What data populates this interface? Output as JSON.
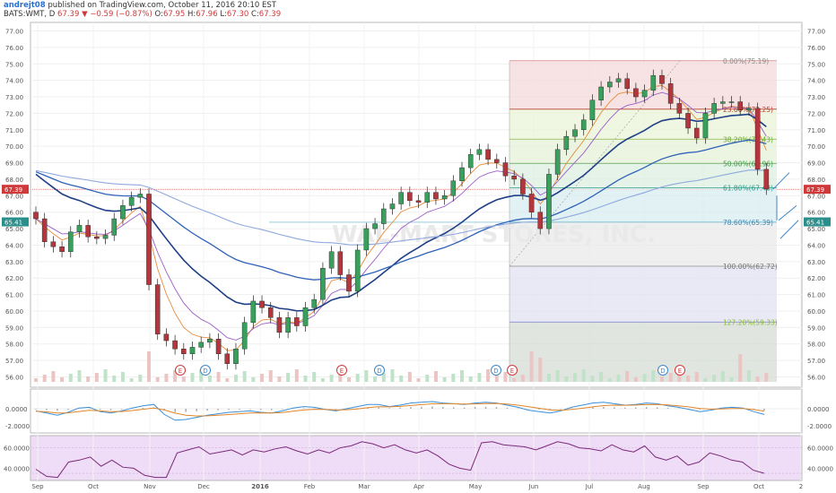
{
  "header": {
    "user": "andrejt08",
    "published": "published on TradingView.com, October 11, 2016 20:10 EST",
    "symbol": "BATS:WMT, D",
    "last": "67.39",
    "change": "−0.59 (−0.87%)",
    "o_label": "O:",
    "o_value": "67.95",
    "h_label": "H:",
    "h_value": "67.96",
    "l_label": "L:",
    "l_value": "67.30",
    "c_label": "C:",
    "c_value": "67.39"
  },
  "colors": {
    "up": "#3a9e5c",
    "down": "#b2363b",
    "ema_dark": "#1f3f86",
    "ema_mid": "#2e62b8",
    "ema_light": "#8fa9dd",
    "ema_orange": "#e88b3a",
    "ema_purple": "#9c5ec8",
    "rsi_line": "#7a2a7a",
    "rsi_bg": "#efdcf6",
    "macd_blue": "#3a8fd8",
    "macd_orange": "#e0862a"
  },
  "watermark": "WAL‑MART STORES, INC.",
  "chart_data": {
    "type": "candlestick",
    "symbol": "BATS:WMT",
    "interval": "D",
    "y_ticks": [
      "77.00",
      "76.00",
      "75.00",
      "74.00",
      "73.00",
      "72.00",
      "71.00",
      "70.00",
      "69.00",
      "68.00",
      "67.00",
      "66.00",
      "65.00",
      "64.00",
      "63.00",
      "62.00",
      "61.00",
      "60.00",
      "59.00",
      "58.00",
      "57.00",
      "56.00"
    ],
    "ylim": [
      55.7,
      77.3
    ],
    "price_labels": [
      {
        "value": 67.39,
        "text": "67.39",
        "color": "#d0393a"
      },
      {
        "value": 65.41,
        "text": "65.41",
        "color": "#2a8f8a"
      }
    ],
    "x_ticks": [
      "Sep",
      "Oct",
      "Nov",
      "Dec",
      "2016",
      "Feb",
      "Mar",
      "Apr",
      "May",
      "Jun",
      "Jul",
      "Aug",
      "Sep",
      "Oct",
      "2"
    ],
    "fibonacci": [
      {
        "level": "0.00%",
        "price": 75.19,
        "label": "0.00%(75.19)"
      },
      {
        "level": "23.60%",
        "price": 72.25,
        "label": "23.60%(72.25)"
      },
      {
        "level": "38.20%",
        "price": 70.43,
        "label": "38.20%(70.43)"
      },
      {
        "level": "50.00%",
        "price": 68.96,
        "label": "50.00%(68.96)"
      },
      {
        "level": "61.80%",
        "price": 67.48,
        "label": "61.80%(67.48)"
      },
      {
        "level": "78.60%",
        "price": 65.39,
        "label": "78.60%(65.39)"
      },
      {
        "level": "100.00%",
        "price": 62.72,
        "label": "100.00%(62.72)"
      },
      {
        "level": "127.20%",
        "price": 59.33,
        "label": "127.20%(59.33)"
      }
    ],
    "events": [
      {
        "type": "E",
        "month": "Nov"
      },
      {
        "type": "D",
        "month": "Dec"
      },
      {
        "type": "E",
        "month": "Feb"
      },
      {
        "type": "D",
        "month": "Mar"
      },
      {
        "type": "D",
        "month": "May"
      },
      {
        "type": "E",
        "month": "May"
      },
      {
        "type": "D",
        "month": "Aug"
      },
      {
        "type": "E",
        "month": "Aug"
      }
    ],
    "series": [
      {
        "name": "close",
        "values": [
          65.6,
          64.2,
          63.9,
          63.6,
          64.8,
          65.2,
          64.5,
          64.4,
          64.6,
          65.6,
          66.4,
          66.9,
          67.1,
          61.6,
          58.6,
          58.2,
          57.7,
          57.4,
          57.8,
          58.1,
          58.3,
          57.4,
          56.8,
          57.7,
          59.3,
          60.6,
          60.2,
          59.6,
          58.7,
          59.6,
          59.1,
          60.2,
          60.7,
          62.6,
          63.6,
          62.2,
          61.2,
          63.7,
          65.0,
          65.3,
          66.2,
          66.5,
          67.2,
          66.7,
          66.6,
          67.2,
          66.8,
          67.0,
          67.9,
          68.7,
          69.5,
          69.8,
          69.2,
          69.0,
          68.2,
          68.0,
          67.1,
          66.0,
          65.0,
          68.3,
          69.8,
          70.6,
          71.0,
          71.6,
          72.8,
          73.6,
          73.9,
          74.1,
          73.5,
          73.0,
          73.4,
          74.3,
          73.8,
          72.6,
          72.0,
          71.1,
          70.5,
          72.0,
          72.6,
          72.7,
          72.7,
          72.2,
          72.3,
          68.6,
          67.4
        ]
      },
      {
        "name": "macd",
        "values": [
          -0.3,
          -0.6,
          -0.9,
          -0.5,
          0.1,
          0.2,
          -0.4,
          -0.6,
          -0.3,
          0.1,
          0.4,
          0.6,
          -0.8,
          -1.6,
          -1.5,
          -1.2,
          -0.9,
          -0.7,
          -0.5,
          -0.4,
          -0.3,
          -0.5,
          -0.6,
          -0.3,
          0.1,
          0.3,
          0.2,
          -0.1,
          -0.3,
          0,
          0.3,
          0.6,
          0.6,
          0.3,
          0.5,
          0.8,
          0.9,
          1,
          0.8,
          0.7,
          0.6,
          0.8,
          0.9,
          0.8,
          0.5,
          0.2,
          -0.2,
          -0.4,
          -0.6,
          -0.3,
          0.2,
          0.5,
          0.8,
          0.9,
          0.7,
          0.5,
          0.6,
          0.8,
          0.7,
          0.4,
          0.2,
          -0.1,
          -0.4,
          -0.2,
          0.1,
          0.2,
          0.1,
          -0.4,
          -0.8
        ]
      },
      {
        "name": "rsi",
        "values": [
          39,
          32,
          31,
          46,
          48,
          51,
          42,
          48,
          41,
          40,
          33,
          31,
          31,
          55,
          58,
          61,
          54,
          56,
          58,
          53,
          58,
          56,
          59,
          61,
          57,
          54,
          58,
          55,
          60,
          62,
          66,
          64,
          60,
          63,
          58,
          55,
          58,
          52,
          44,
          40,
          38,
          65,
          66,
          63,
          62,
          61,
          58,
          62,
          66,
          64,
          60,
          59,
          57,
          63,
          58,
          56,
          62,
          51,
          48,
          52,
          43,
          46,
          55,
          52,
          48,
          46,
          38,
          35
        ]
      }
    ],
    "rsi_ticks": [
      "60.0000",
      "40.0000"
    ],
    "macd_ticks": [
      "0.0000",
      "-2.0000"
    ]
  }
}
